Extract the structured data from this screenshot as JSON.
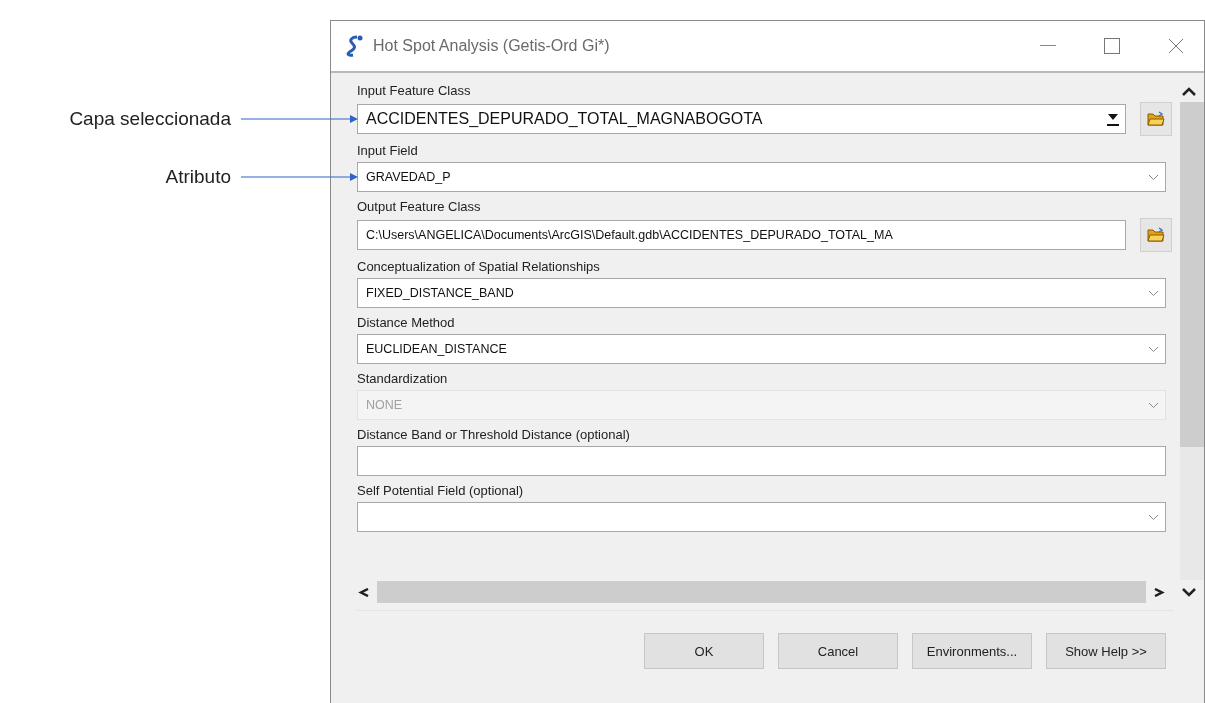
{
  "window": {
    "title": "Hot Spot Analysis (Getis-Ord Gi*)"
  },
  "parameters": [
    {
      "label": "Input Feature Class",
      "kind": "combo-browse",
      "value": "ACCIDENTES_DEPURADO_TOTAL_MAGNABOGOTA",
      "disabled": false,
      "callout": "Capa seleccionada"
    },
    {
      "label": "Input Field",
      "kind": "dropdown",
      "value": "GRAVEDAD_P",
      "disabled": false,
      "callout": "Atributo"
    },
    {
      "label": "Output Feature Class",
      "kind": "text-browse",
      "value": "C:\\Users\\ANGELICA\\Documents\\ArcGIS\\Default.gdb\\ACCIDENTES_DEPURADO_TOTAL_MA",
      "disabled": false
    },
    {
      "label": "Conceptualization of Spatial Relationships",
      "kind": "dropdown",
      "value": "FIXED_DISTANCE_BAND",
      "disabled": false
    },
    {
      "label": "Distance Method",
      "kind": "dropdown",
      "value": "EUCLIDEAN_DISTANCE",
      "disabled": false
    },
    {
      "label": "Standardization",
      "kind": "dropdown",
      "value": "NONE",
      "disabled": true
    },
    {
      "label": "Distance Band or Threshold Distance (optional)",
      "kind": "text",
      "disabled": false
    },
    {
      "label": "Self Potential Field (optional)",
      "kind": "dropdown",
      "disabled": false
    }
  ],
  "buttons": [
    "OK",
    "Cancel",
    "Environments...",
    "Show Help >>"
  ]
}
